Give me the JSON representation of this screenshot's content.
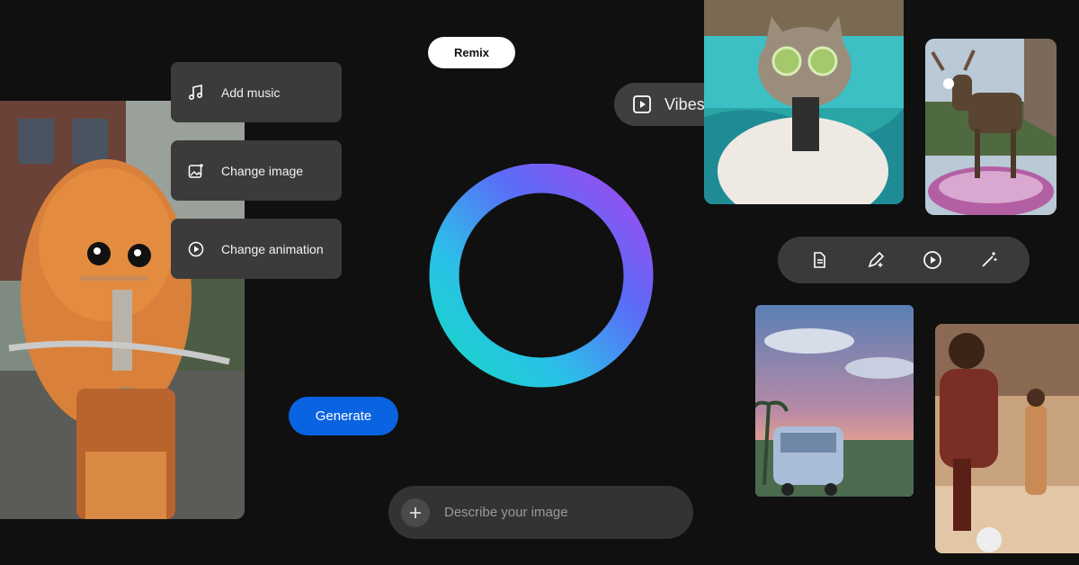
{
  "remix": {
    "label": "Remix"
  },
  "vibes": {
    "label": "Vibes",
    "icon": "play-square-icon"
  },
  "menu": {
    "items": [
      {
        "label": "Add music",
        "icon": "music-note-icon"
      },
      {
        "label": "Change image",
        "icon": "image-sparkle-icon"
      },
      {
        "label": "Change animation",
        "icon": "play-circle-icon"
      }
    ]
  },
  "generate": {
    "label": "Generate",
    "color": "#0a63e0"
  },
  "prompt": {
    "placeholder": "Describe your image",
    "icon": "plus-icon"
  },
  "toolbar": {
    "icons": [
      "document-icon",
      "pencil-sparkle-icon",
      "play-circle-icon",
      "magic-wand-icon"
    ]
  },
  "ring": {
    "gradient": [
      "#a04bf0",
      "#5a6cf7",
      "#2bc0e8",
      "#16d6c6"
    ]
  }
}
